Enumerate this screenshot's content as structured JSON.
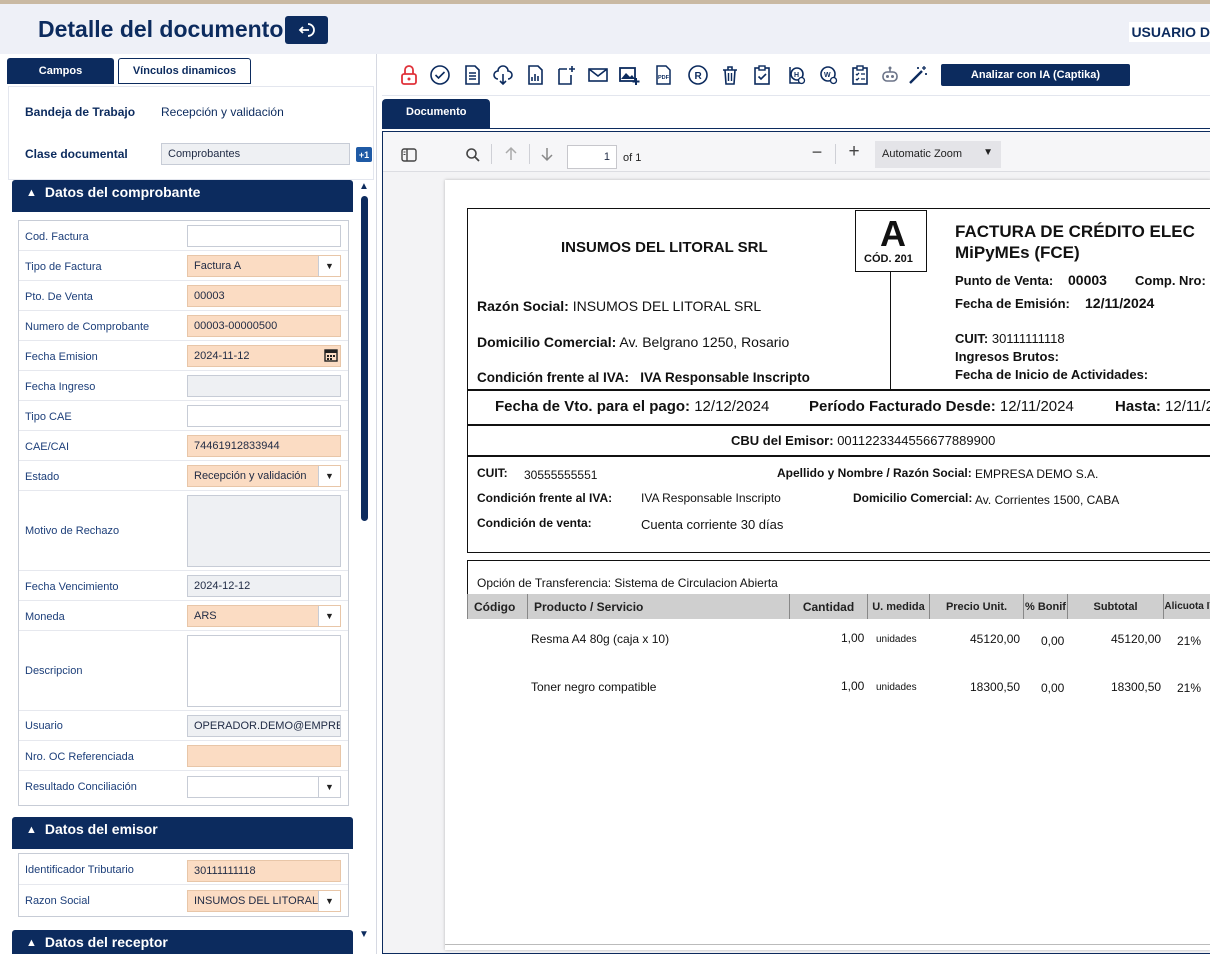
{
  "header": {
    "title": "Detalle del documento",
    "user": "USUARIO D"
  },
  "left": {
    "tabs": [
      "Campos",
      "Vínculos dinamicos"
    ],
    "bandeja_label": "Bandeja de Trabajo",
    "bandeja_value": "Recepción y validación",
    "clase_label": "Clase documental",
    "clase_value": "Comprobantes",
    "plus_badge": "+1",
    "sections": {
      "comprobante": "Datos del comprobante",
      "emisor": "Datos del emisor",
      "receptor": "Datos del receptor"
    },
    "comprobante_fields": [
      {
        "label": "Cod. Factura",
        "value": ""
      },
      {
        "label": "Tipo de Factura",
        "value": "Factura A"
      },
      {
        "label": "Pto. De Venta",
        "value": "00003"
      },
      {
        "label": "Numero de Comprobante",
        "value": "00003-00000500"
      },
      {
        "label": "Fecha Emision",
        "value": "2024-11-12"
      },
      {
        "label": "Fecha Ingreso",
        "value": ""
      },
      {
        "label": "Tipo CAE",
        "value": ""
      },
      {
        "label": "CAE/CAI",
        "value": "74461912833944"
      },
      {
        "label": "Estado",
        "value": "Recepción y validación"
      },
      {
        "label": "Motivo de Rechazo",
        "value": ""
      },
      {
        "label": "Fecha Vencimiento",
        "value": "2024-12-12"
      },
      {
        "label": "Moneda",
        "value": "ARS"
      },
      {
        "label": "Descripcion",
        "value": ""
      },
      {
        "label": "Usuario",
        "value": "OPERADOR.DEMO@EMPRES"
      },
      {
        "label": "Nro. OC Referenciada",
        "value": ""
      },
      {
        "label": "Resultado Conciliación",
        "value": ""
      }
    ],
    "emisor_fields": [
      {
        "label": "Identificador Tributario",
        "value": "30111111118"
      },
      {
        "label": "Razon Social",
        "value": "INSUMOS DEL LITORAL"
      }
    ]
  },
  "toolbar": {
    "ia_button": "Analizar con IA (Captika)",
    "icons": [
      "lock-icon",
      "check-circle-icon",
      "document-icon",
      "cloud-upload-icon",
      "report-icon",
      "add-page-icon",
      "mail-icon",
      "image-add-icon",
      "pdf-icon",
      "r-circle-icon",
      "trash-icon",
      "clipboard-check-icon",
      "history-icon",
      "workflow-icon",
      "checklist-icon",
      "robot-icon",
      "magic-wand-icon"
    ]
  },
  "doc_tab": "Documento",
  "viewer": {
    "page_number": "1",
    "page_total": "of 1",
    "zoom": "Automatic Zoom"
  },
  "invoice": {
    "company": "INSUMOS DEL LITORAL SRL",
    "letter": "A",
    "code": "CÓD. 201",
    "title_line1": "FACTURA DE CRÉDITO ELEC",
    "title_line2": "MiPyMEs (FCE)",
    "punto_venta_label": "Punto de Venta:",
    "punto_venta": "00003",
    "comp_nro_label": "Comp. Nro:",
    "fecha_emision_label": "Fecha de Emisión:",
    "fecha_emision": "12/11/2024",
    "razon_label": "Razón Social:",
    "razon_value": "INSUMOS DEL LITORAL SRL",
    "domicilio_label": "Domicilio Comercial:",
    "domicilio_value": "Av. Belgrano 1250, Rosario",
    "iva_label": "Condición frente al IVA:",
    "iva_value": "IVA Responsable Inscripto",
    "cuit_label": "CUIT:",
    "cuit_value": "30111111118",
    "ingresos_label": "Ingresos Brutos:",
    "inicio_label": "Fecha de Inicio de Actividades:",
    "vto_label": "Fecha de Vto. para el pago:",
    "vto_value": "12/12/2024",
    "periodo_label": "Período Facturado Desde:",
    "periodo_value": "12/11/2024",
    "hasta_label": "Hasta:",
    "hasta_value": "12/11/2",
    "cbu_label": "CBU del Emisor:",
    "cbu_value": "0011223344556677889900",
    "r_cuit_label": "CUIT:",
    "r_cuit_value": "30555555551",
    "r_apellido_label": "Apellido y Nombre / Razón Social:",
    "r_apellido_value": "EMPRESA DEMO S.A.",
    "r_iva_label": "Condición frente al IVA:",
    "r_iva_value": "IVA Responsable Inscripto",
    "r_dom_label": "Domicilio Comercial:",
    "r_dom_value": "Av. Corrientes 1500, CABA",
    "r_venta_label": "Condición de venta:",
    "r_venta_value": "Cuenta corriente 30 días",
    "transferencia": "Opción de Transferencia: Sistema de Circulacion Abierta",
    "columns": [
      "Código",
      "Producto / Servicio",
      "Cantidad",
      "U. medida",
      "Precio Unit.",
      "% Bonif",
      "Subtotal",
      "Alicuota IVA"
    ],
    "rows": [
      {
        "producto": "Resma A4 80g (caja x 10)",
        "cantidad": "1,00",
        "umedida": "unidades",
        "precio": "45120,00",
        "bonif": "0,00",
        "subtotal": "45120,00",
        "iva": "21%"
      },
      {
        "producto": "Toner negro compatible",
        "cantidad": "1,00",
        "umedida": "unidades",
        "precio": "18300,50",
        "bonif": "0,00",
        "subtotal": "18300,50",
        "iva": "21%"
      }
    ]
  }
}
